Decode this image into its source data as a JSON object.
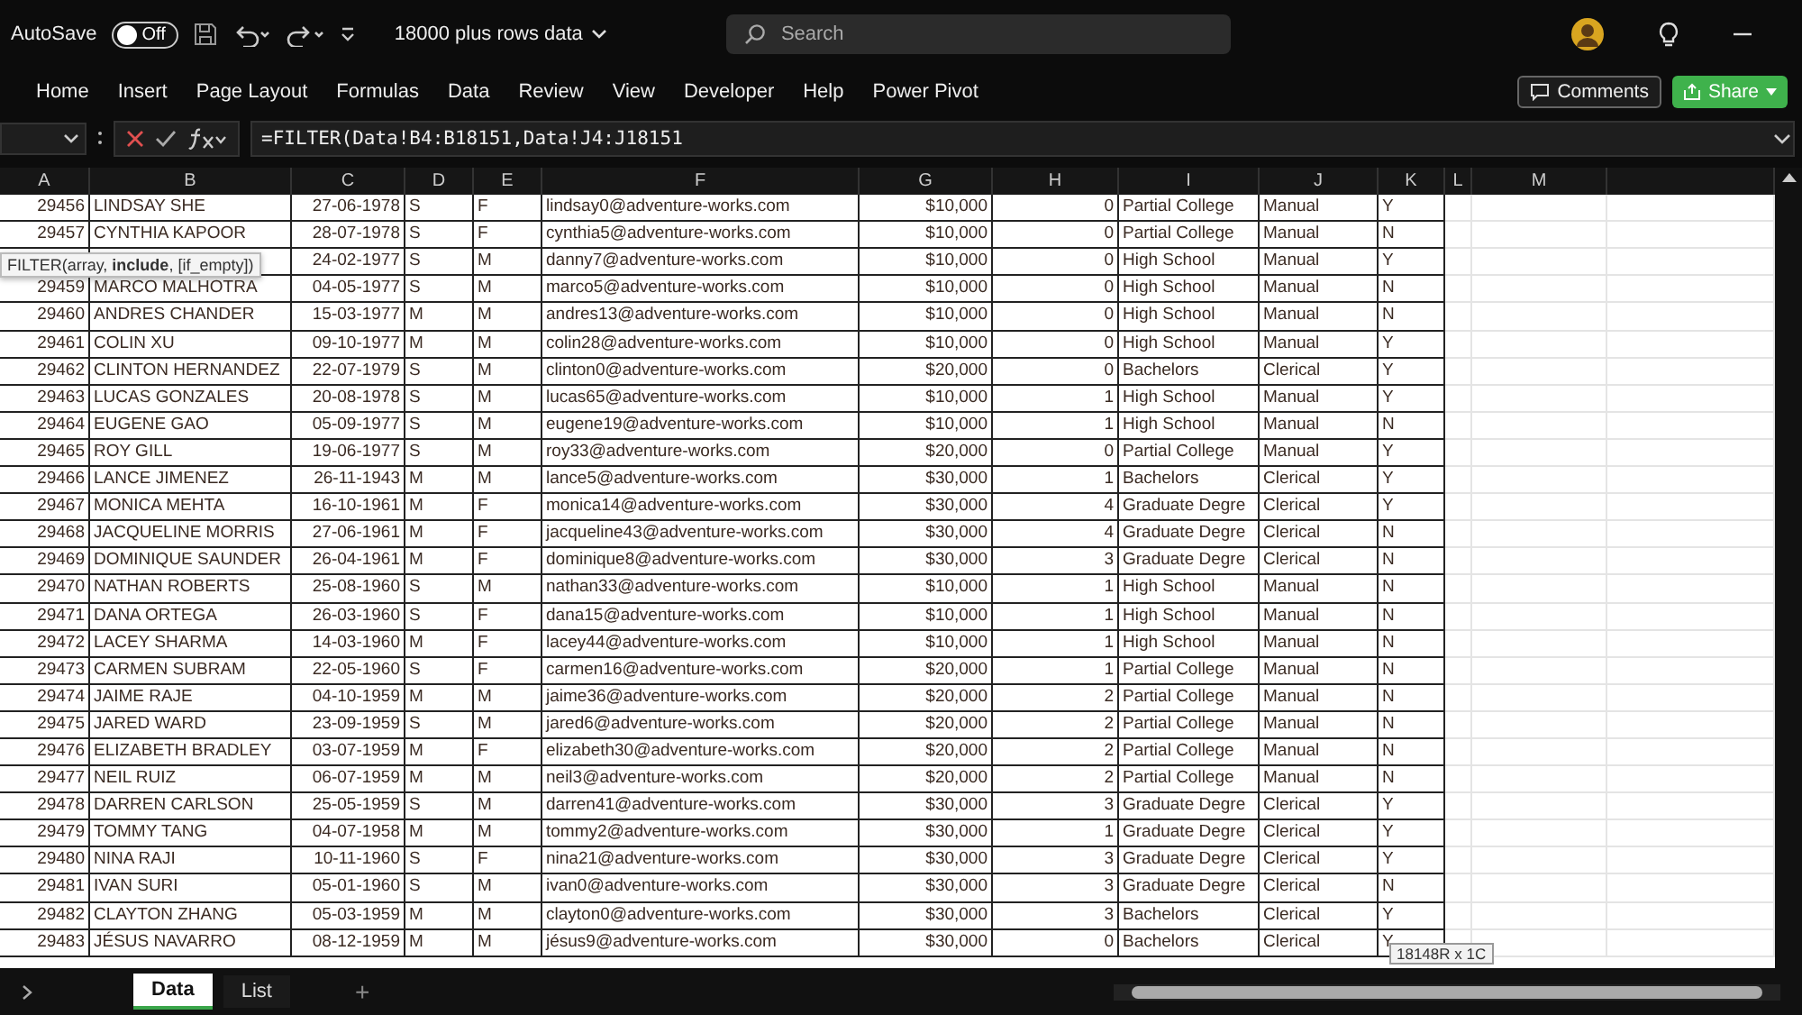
{
  "title_bar": {
    "autosave_label": "AutoSave",
    "autosave_toggle": {
      "label": "Off",
      "on": false
    },
    "document_title": "18000 plus rows data",
    "search": {
      "placeholder": "Search"
    }
  },
  "ribbon_tabs": [
    {
      "label": "Home",
      "selected": false
    },
    {
      "label": "Insert",
      "selected": false
    },
    {
      "label": "Page Layout",
      "selected": false
    },
    {
      "label": "Formulas",
      "selected": false
    },
    {
      "label": "Data",
      "selected": false
    },
    {
      "label": "Review",
      "selected": false
    },
    {
      "label": "View",
      "selected": false
    },
    {
      "label": "Developer",
      "selected": false
    },
    {
      "label": "Help",
      "selected": false
    },
    {
      "label": "Power Pivot",
      "selected": false
    }
  ],
  "ribbon_buttons": {
    "comments": "Comments",
    "share": "Share"
  },
  "formula_bar": {
    "formula": "=FILTER(Data!B4:B18151,Data!J4:J18151"
  },
  "function_tooltip": {
    "prefix": "FILTER(array, ",
    "current": "include",
    "suffix": ", [if_empty])"
  },
  "columns": [
    "A",
    "B",
    "C",
    "D",
    "E",
    "F",
    "G",
    "H",
    "I",
    "J",
    "K",
    "L",
    "M"
  ],
  "rows": [
    {
      "cells": [
        "29456",
        "LINDSAY SHE",
        "27-06-1978",
        "S",
        "F",
        "lindsay0@adventure-works.com",
        "$10,000",
        "0",
        "Partial College",
        "Manual",
        "Y"
      ]
    },
    {
      "cells": [
        "29457",
        "CYNTHIA KAPOOR",
        "28-07-1978",
        "S",
        "F",
        "cynthia5@adventure-works.com",
        "$10,000",
        "0",
        "Partial College",
        "Manual",
        "N"
      ]
    },
    {
      "cells": [
        null,
        null,
        "24-02-1977",
        "S",
        "M",
        "danny7@adventure-works.com",
        "$10,000",
        "0",
        "High School",
        "Manual",
        "Y"
      ]
    },
    {
      "cells": [
        "29459",
        "MARCO MALHOTRA",
        "04-05-1977",
        "S",
        "M",
        "marco5@adventure-works.com",
        "$10,000",
        "0",
        "High School",
        "Manual",
        "N"
      ]
    },
    {
      "cells": [
        "29460",
        "ANDRES CHANDER",
        "15-03-1977",
        "M",
        "M",
        "andres13@adventure-works.com",
        "$10,000",
        "0",
        "High School",
        "Manual",
        "N"
      ]
    },
    {
      "cells": [
        "29461",
        "COLIN XU",
        "09-10-1977",
        "M",
        "M",
        "colin28@adventure-works.com",
        "$10,000",
        "0",
        "High School",
        "Manual",
        "Y"
      ]
    },
    {
      "cells": [
        "29462",
        "CLINTON HERNANDEZ",
        "22-07-1979",
        "S",
        "M",
        "clinton0@adventure-works.com",
        "$20,000",
        "0",
        "Bachelors",
        "Clerical",
        "Y"
      ]
    },
    {
      "cells": [
        "29463",
        "LUCAS GONZALES",
        "20-08-1978",
        "S",
        "M",
        "lucas65@adventure-works.com",
        "$10,000",
        "1",
        "High School",
        "Manual",
        "Y"
      ]
    },
    {
      "cells": [
        "29464",
        "EUGENE GAO",
        "05-09-1977",
        "S",
        "M",
        "eugene19@adventure-works.com",
        "$10,000",
        "1",
        "High School",
        "Manual",
        "N"
      ]
    },
    {
      "cells": [
        "29465",
        "ROY GILL",
        "19-06-1977",
        "S",
        "M",
        "roy33@adventure-works.com",
        "$20,000",
        "0",
        "Partial College",
        "Manual",
        "Y"
      ]
    },
    {
      "cells": [
        "29466",
        "LANCE JIMENEZ",
        "26-11-1943",
        "M",
        "M",
        "lance5@adventure-works.com",
        "$30,000",
        "1",
        "Bachelors",
        "Clerical",
        "Y"
      ]
    },
    {
      "cells": [
        "29467",
        "MONICA MEHTA",
        "16-10-1961",
        "M",
        "F",
        "monica14@adventure-works.com",
        "$30,000",
        "4",
        "Graduate Degre",
        "Clerical",
        "Y"
      ]
    },
    {
      "cells": [
        "29468",
        "JACQUELINE MORRIS",
        "27-06-1961",
        "M",
        "F",
        "jacqueline43@adventure-works.com",
        "$30,000",
        "4",
        "Graduate Degre",
        "Clerical",
        "N"
      ]
    },
    {
      "cells": [
        "29469",
        "DOMINIQUE SAUNDER",
        "26-04-1961",
        "M",
        "F",
        "dominique8@adventure-works.com",
        "$30,000",
        "3",
        "Graduate Degre",
        "Clerical",
        "N"
      ]
    },
    {
      "cells": [
        "29470",
        "NATHAN ROBERTS",
        "25-08-1960",
        "S",
        "M",
        "nathan33@adventure-works.com",
        "$10,000",
        "1",
        "High School",
        "Manual",
        "N"
      ]
    },
    {
      "cells": [
        "29471",
        "DANA ORTEGA",
        "26-03-1960",
        "S",
        "F",
        "dana15@adventure-works.com",
        "$10,000",
        "1",
        "High School",
        "Manual",
        "N"
      ]
    },
    {
      "cells": [
        "29472",
        "LACEY SHARMA",
        "14-03-1960",
        "M",
        "F",
        "lacey44@adventure-works.com",
        "$10,000",
        "1",
        "High School",
        "Manual",
        "N"
      ]
    },
    {
      "cells": [
        "29473",
        "CARMEN SUBRAM",
        "22-05-1960",
        "S",
        "F",
        "carmen16@adventure-works.com",
        "$20,000",
        "1",
        "Partial College",
        "Manual",
        "N"
      ]
    },
    {
      "cells": [
        "29474",
        "JAIME RAJE",
        "04-10-1959",
        "M",
        "M",
        "jaime36@adventure-works.com",
        "$20,000",
        "2",
        "Partial College",
        "Manual",
        "N"
      ]
    },
    {
      "cells": [
        "29475",
        "JARED WARD",
        "23-09-1959",
        "S",
        "M",
        "jared6@adventure-works.com",
        "$20,000",
        "2",
        "Partial College",
        "Manual",
        "N"
      ]
    },
    {
      "cells": [
        "29476",
        "ELIZABETH BRADLEY",
        "03-07-1959",
        "M",
        "F",
        "elizabeth30@adventure-works.com",
        "$20,000",
        "2",
        "Partial College",
        "Manual",
        "N"
      ]
    },
    {
      "cells": [
        "29477",
        "NEIL RUIZ",
        "06-07-1959",
        "M",
        "M",
        "neil3@adventure-works.com",
        "$20,000",
        "2",
        "Partial College",
        "Manual",
        "N"
      ]
    },
    {
      "cells": [
        "29478",
        "DARREN CARLSON",
        "25-05-1959",
        "S",
        "M",
        "darren41@adventure-works.com",
        "$30,000",
        "3",
        "Graduate Degre",
        "Clerical",
        "Y"
      ]
    },
    {
      "cells": [
        "29479",
        "TOMMY TANG",
        "04-07-1958",
        "M",
        "M",
        "tommy2@adventure-works.com",
        "$30,000",
        "1",
        "Graduate Degre",
        "Clerical",
        "Y"
      ]
    },
    {
      "cells": [
        "29480",
        "NINA RAJI",
        "10-11-1960",
        "S",
        "F",
        "nina21@adventure-works.com",
        "$30,000",
        "3",
        "Graduate Degre",
        "Clerical",
        "Y"
      ]
    },
    {
      "cells": [
        "29481",
        "IVAN SURI",
        "05-01-1960",
        "S",
        "M",
        "ivan0@adventure-works.com",
        "$30,000",
        "3",
        "Graduate Degre",
        "Clerical",
        "N"
      ]
    },
    {
      "cells": [
        "29482",
        "CLAYTON ZHANG",
        "05-03-1959",
        "M",
        "M",
        "clayton0@adventure-works.com",
        "$30,000",
        "3",
        "Bachelors",
        "Clerical",
        "Y"
      ]
    },
    {
      "cells": [
        "29483",
        "JÉSUS NAVARRO",
        "08-12-1959",
        "M",
        "M",
        "jésus9@adventure-works.com",
        "$30,000",
        "0",
        "Bachelors",
        "Clerical",
        "Y"
      ]
    }
  ],
  "selection_tooltip": "18148R x 1C",
  "sheet_tabs": [
    {
      "label": "Data",
      "selected": true
    },
    {
      "label": "List",
      "selected": false
    }
  ],
  "add_sheet": "+"
}
